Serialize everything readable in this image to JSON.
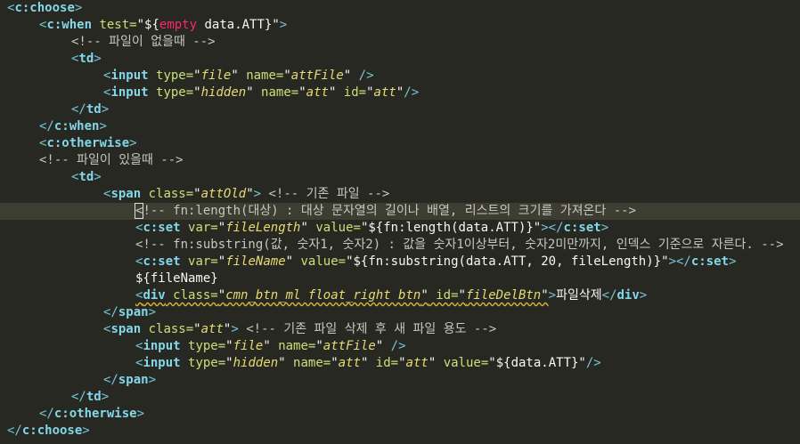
{
  "editor": {
    "lines": [
      {
        "t": [
          "<",
          "c:choose",
          ">"
        ]
      },
      {
        "t": [
          "<",
          "c:when",
          " test=",
          "\"${",
          "empty",
          " data.ATT}\"",
          ">"
        ]
      },
      {
        "t": [
          "<!-- 파일이 없을때 -->"
        ]
      },
      {
        "t": [
          "<",
          "td",
          ">"
        ]
      },
      {
        "t": [
          "<",
          "input",
          " type=",
          "\"",
          "file",
          "\"",
          " name=",
          "\"",
          "attFile",
          "\"",
          " />"
        ]
      },
      {
        "t": [
          "<",
          "input",
          " type=",
          "\"",
          "hidden",
          "\"",
          " name=",
          "\"",
          "att",
          "\"",
          " id=",
          "\"",
          "att",
          "\"",
          "/>"
        ]
      },
      {
        "t": [
          "</",
          "td",
          ">"
        ]
      },
      {
        "t": [
          "</",
          "c:when",
          ">"
        ]
      },
      {
        "t": [
          "<",
          "c:otherwise",
          ">"
        ]
      },
      {
        "t": [
          "<!-- 파일이 있을때 -->"
        ]
      },
      {
        "t": [
          "<",
          "td",
          ">"
        ]
      },
      {
        "t": [
          "<",
          "span",
          " class=",
          "\"",
          "attOld",
          "\"",
          ">",
          " <!-- 기존 파일 -->"
        ]
      },
      {
        "t": [
          "<",
          "!-- fn:length(대상) : 대상 문자열의 길이나 배열, 리스트의 크기를 가져온다 -->"
        ]
      },
      {
        "t": [
          "<",
          "c:set",
          " var=",
          "\"",
          "fileLength",
          "\"",
          " value=",
          "\"${fn:length(data.ATT)}\"",
          "></",
          "c:set",
          ">"
        ]
      },
      {
        "t": [
          "<!-- fn:substring(값, 숫자1, 숫자2) : 값을 숫자1이상부터, 숫자2미만까지, 인덱스 기준으로 자른다. -->"
        ]
      },
      {
        "t": [
          "<",
          "c:set",
          " var=",
          "\"",
          "fileName",
          "\"",
          " value=",
          "\"${fn:substring(data.ATT, 20, fileLength)}\"",
          "></",
          "c:set",
          ">"
        ]
      },
      {
        "t": [
          "${fileName}"
        ]
      },
      {
        "t": [
          "<",
          "div",
          " class=",
          "\"",
          "cmn_btn_ml float_right btn",
          "\"",
          " id=",
          "\"",
          "fileDelBtn",
          "\"",
          ">",
          "파일삭제",
          "</",
          "div",
          ">"
        ]
      },
      {
        "t": [
          "</",
          "span",
          ">"
        ]
      },
      {
        "t": [
          "<",
          "span",
          " class=",
          "\"",
          "att",
          "\"",
          ">",
          " <!-- 기존 파일 삭제 후 새 파일 용도 -->"
        ]
      },
      {
        "t": [
          "<",
          "input",
          " type=",
          "\"",
          "file",
          "\"",
          " name=",
          "\"",
          "attFile",
          "\"",
          " />"
        ]
      },
      {
        "t": [
          "<",
          "input",
          " type=",
          "\"",
          "hidden",
          "\"",
          " name=",
          "\"",
          "att",
          "\"",
          " id=",
          "\"",
          "att",
          "\"",
          " value=",
          "\"${data.ATT}\"",
          "/>"
        ]
      },
      {
        "t": [
          "</",
          "span",
          ">"
        ]
      },
      {
        "t": [
          "</",
          "td",
          ">"
        ]
      },
      {
        "t": [
          "</",
          "c:otherwise",
          ">"
        ]
      },
      {
        "t": [
          "</",
          "c:choose",
          ">"
        ]
      }
    ]
  },
  "colors": {
    "background": "#272822",
    "current_line": "#3e3d32",
    "tag": "#84d7ea",
    "attribute": "#c9e07a",
    "string": "#e6db74",
    "keyword": "#f92672",
    "comment": "#c7c7bf"
  }
}
